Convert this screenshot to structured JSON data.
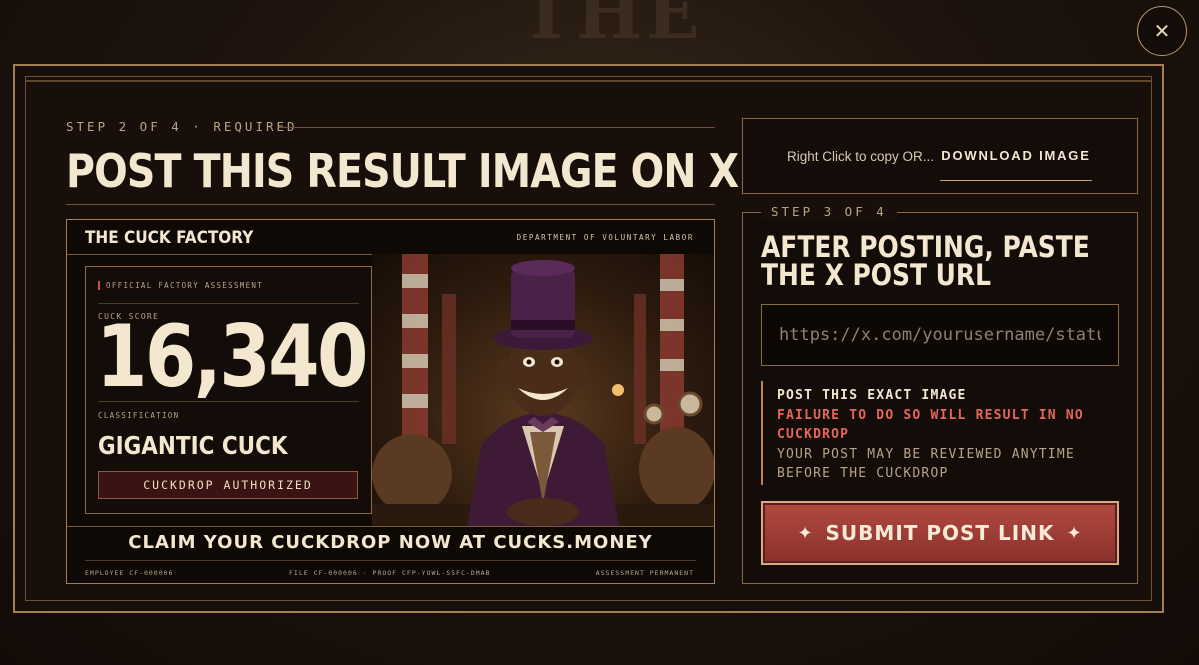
{
  "background": {
    "text": "THE"
  },
  "close": {
    "icon": "close-icon",
    "glyph": "✕"
  },
  "left": {
    "step": "STEP 2 OF 4 · REQUIRED",
    "title": "POST THIS RESULT IMAGE ON X"
  },
  "card": {
    "title": "THE CUCK FACTORY",
    "dept": "DEPARTMENT OF VOLUNTARY LABOR",
    "assessment_tag": "OFFICIAL FACTORY ASSESSMENT",
    "score_label": "CUCK SCORE",
    "score": "16,340",
    "classification_label": "CLASSIFICATION",
    "classification": "GIGANTIC CUCK",
    "authorized": "CUCKDROP AUTHORIZED",
    "claim": "CLAIM YOUR CUCKDROP NOW AT CUCKS.MONEY",
    "employee": "EMPLOYEE CF-000006",
    "file": "FILE CF-000006 · PROOF CFP-YOWL-S5FC-DMAB",
    "permanent": "ASSESSMENT PERMANENT"
  },
  "download": {
    "hint": "Right Click to copy OR...",
    "button": "DOWNLOAD IMAGE"
  },
  "step3": {
    "step": "STEP 3 OF 4",
    "title_line1": "AFTER POSTING, PASTE",
    "title_line2": "THE X POST URL",
    "url_value": "",
    "url_placeholder": "https://x.com/yourusername/status/...",
    "warn_1": "POST THIS EXACT IMAGE",
    "warn_2": "FAILURE TO DO SO WILL RESULT IN NO CUCKDROP",
    "warn_3": "YOUR POST MAY BE REVIEWED ANYTIME BEFORE THE CUCKDROP",
    "submit": "SUBMIT POST LINK",
    "star": "✦"
  },
  "colors": {
    "accent": "#a57e52",
    "danger": "#e2675c",
    "submit": "#a03d36"
  }
}
